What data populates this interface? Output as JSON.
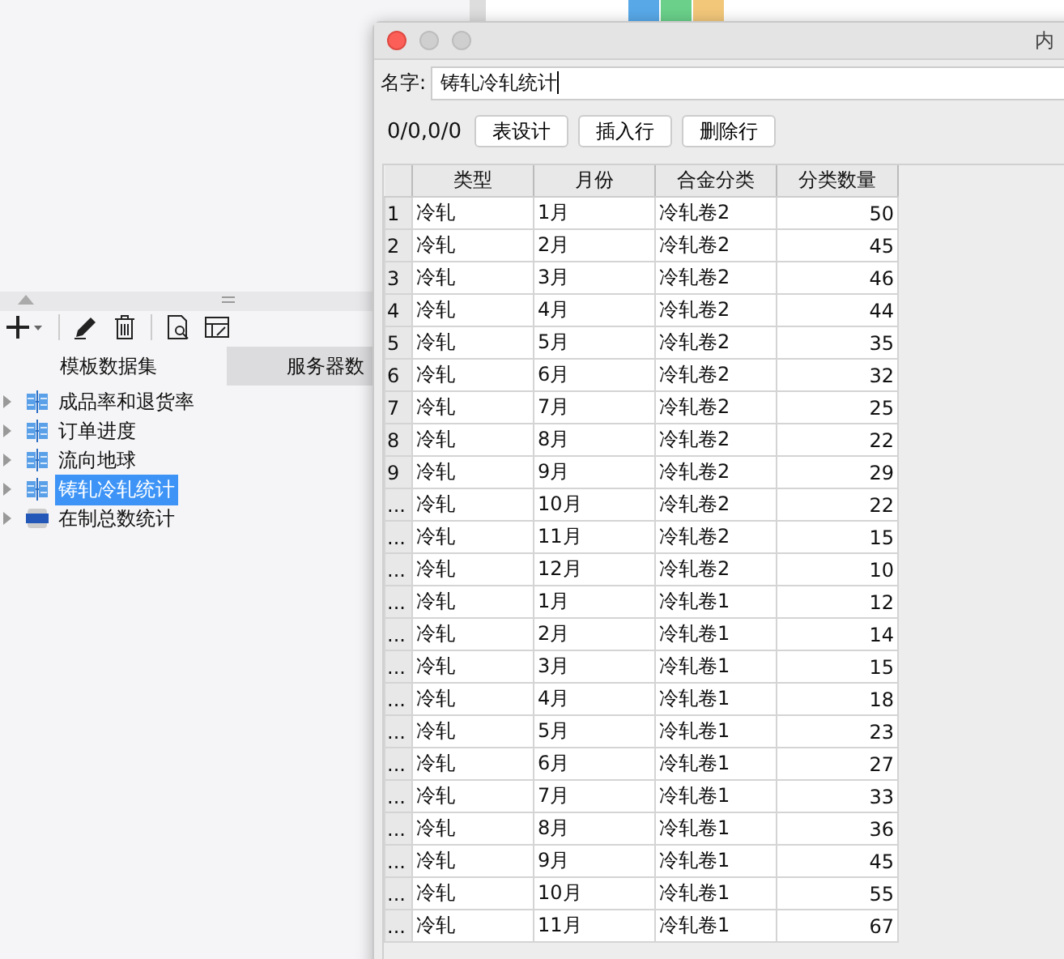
{
  "tabs": [
    {
      "label": "模板数据集",
      "selected": true
    },
    {
      "label": "服务器数",
      "selected": false
    }
  ],
  "tree": [
    {
      "label": "成品率和退货率",
      "kind": "db",
      "selected": false
    },
    {
      "label": "订单进度",
      "kind": "db",
      "selected": false
    },
    {
      "label": "流向地球",
      "kind": "db",
      "selected": false
    },
    {
      "label": "铸轧冷轧统计",
      "kind": "db",
      "selected": true
    },
    {
      "label": "在制总数统计",
      "kind": "json",
      "selected": false
    }
  ],
  "dialog": {
    "title": "内",
    "name_label": "名字:",
    "name_value": "铸轧冷轧统计",
    "position": "0/0,0/0",
    "buttons": [
      "表设计",
      "插入行",
      "删除行"
    ],
    "columns": [
      "类型",
      "月份",
      "合金分类",
      "分类数量"
    ],
    "rows": [
      {
        "num": "1",
        "cells": [
          "冷轧",
          "1月",
          "冷轧卷2",
          "50"
        ]
      },
      {
        "num": "2",
        "cells": [
          "冷轧",
          "2月",
          "冷轧卷2",
          "45"
        ]
      },
      {
        "num": "3",
        "cells": [
          "冷轧",
          "3月",
          "冷轧卷2",
          "46"
        ]
      },
      {
        "num": "4",
        "cells": [
          "冷轧",
          "4月",
          "冷轧卷2",
          "44"
        ]
      },
      {
        "num": "5",
        "cells": [
          "冷轧",
          "5月",
          "冷轧卷2",
          "35"
        ]
      },
      {
        "num": "6",
        "cells": [
          "冷轧",
          "6月",
          "冷轧卷2",
          "32"
        ]
      },
      {
        "num": "7",
        "cells": [
          "冷轧",
          "7月",
          "冷轧卷2",
          "25"
        ]
      },
      {
        "num": "8",
        "cells": [
          "冷轧",
          "8月",
          "冷轧卷2",
          "22"
        ]
      },
      {
        "num": "9",
        "cells": [
          "冷轧",
          "9月",
          "冷轧卷2",
          "29"
        ]
      },
      {
        "num": "...",
        "cells": [
          "冷轧",
          "10月",
          "冷轧卷2",
          "22"
        ]
      },
      {
        "num": "...",
        "cells": [
          "冷轧",
          "11月",
          "冷轧卷2",
          "15"
        ]
      },
      {
        "num": "...",
        "cells": [
          "冷轧",
          "12月",
          "冷轧卷2",
          "10"
        ]
      },
      {
        "num": "...",
        "cells": [
          "冷轧",
          "1月",
          "冷轧卷1",
          "12"
        ]
      },
      {
        "num": "...",
        "cells": [
          "冷轧",
          "2月",
          "冷轧卷1",
          "14"
        ]
      },
      {
        "num": "...",
        "cells": [
          "冷轧",
          "3月",
          "冷轧卷1",
          "15"
        ]
      },
      {
        "num": "...",
        "cells": [
          "冷轧",
          "4月",
          "冷轧卷1",
          "18"
        ]
      },
      {
        "num": "...",
        "cells": [
          "冷轧",
          "5月",
          "冷轧卷1",
          "23"
        ]
      },
      {
        "num": "...",
        "cells": [
          "冷轧",
          "6月",
          "冷轧卷1",
          "27"
        ]
      },
      {
        "num": "...",
        "cells": [
          "冷轧",
          "7月",
          "冷轧卷1",
          "33"
        ]
      },
      {
        "num": "...",
        "cells": [
          "冷轧",
          "8月",
          "冷轧卷1",
          "36"
        ]
      },
      {
        "num": "...",
        "cells": [
          "冷轧",
          "9月",
          "冷轧卷1",
          "45"
        ]
      },
      {
        "num": "...",
        "cells": [
          "冷轧",
          "10月",
          "冷轧卷1",
          "55"
        ]
      },
      {
        "num": "...",
        "cells": [
          "冷轧",
          "11月",
          "冷轧卷1",
          "67"
        ]
      }
    ]
  }
}
